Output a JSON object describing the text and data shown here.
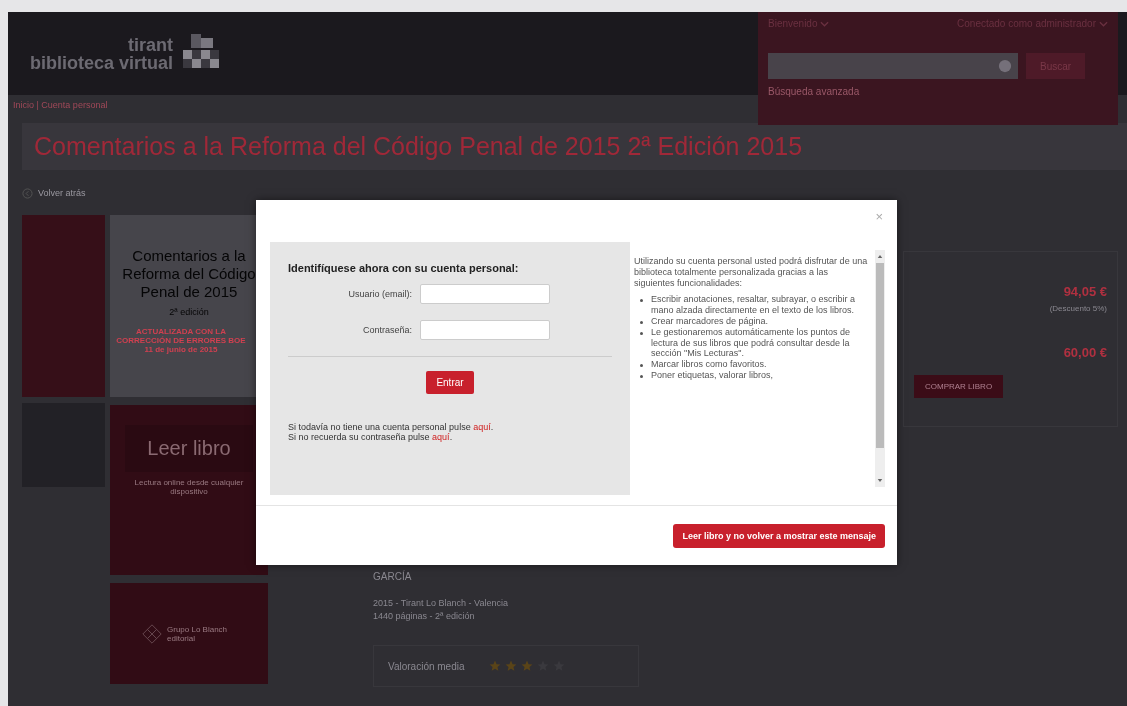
{
  "header": {
    "logo_top": "tirant",
    "logo_bottom": "biblioteca virtual",
    "user_menu": "Bienvenido",
    "account_menu": "Conectado como administrador",
    "search": {
      "button": "Buscar",
      "advanced": "Búsqueda avanzada"
    }
  },
  "breadcrumb": "Inicio | Cuenta personal",
  "title": "Comentarios a la Reforma del Código Penal de 2015 2ª Edición 2015",
  "back": "Volver atrás",
  "cover": {
    "title": "Comentarios a la Reforma del Código Penal de 2015",
    "edition": "2ª edición",
    "note": "ACTUALIZADA CON LA CORRECCIÓN DE ERRORES BOE 11 de junio de 2015",
    "read": "Leer libro",
    "read_note": "Lectura online desde cualquier dispositivo",
    "publisher": "Grupo Lo Blanch editorial"
  },
  "details": {
    "author": "GARCÍA",
    "lines": [
      "2015 - Tirant Lo Blanch - Valencia",
      "1440 páginas - 2ª edición"
    ],
    "rating_label": "Valoración media",
    "stars": 3
  },
  "prices": {
    "price_1": "94,05 €",
    "price_1_note": "(Descuento 5%)",
    "price_2": "60,00 €",
    "buy": "COMPRAR LIBRO"
  },
  "modal": {
    "close": "×",
    "login": {
      "heading": "Identifíquese ahora con su cuenta personal:",
      "fields": [
        {
          "label": "Usuario (email):"
        },
        {
          "label": "Contraseña:"
        }
      ],
      "submit": "Entrar",
      "help": [
        {
          "text": "Si todavía no tiene una cuenta personal pulse ",
          "link": "aquí",
          "end": "."
        },
        {
          "text": "Si no recuerda su contraseña pulse ",
          "link": "aquí",
          "end": "."
        }
      ]
    },
    "info": {
      "intro": "Utilizando su cuenta personal usted podrá disfrutar de una biblioteca totalmente personalizada gracias a las siguientes funcionalidades:",
      "items": [
        "Escribir anotaciones, resaltar, subrayar, o escribir a mano alzada directamente en el texto de los libros.",
        "Crear marcadores de página.",
        "Le gestionaremos automáticamente los puntos de lectura de sus libros que podrá consultar desde la sección \"Mis Lecturas\".",
        "Marcar libros como favoritos.",
        "Poner etiquetas, valorar libros,"
      ]
    },
    "footer_button": "Leer libro y no volver a mostrar este mensaje"
  }
}
